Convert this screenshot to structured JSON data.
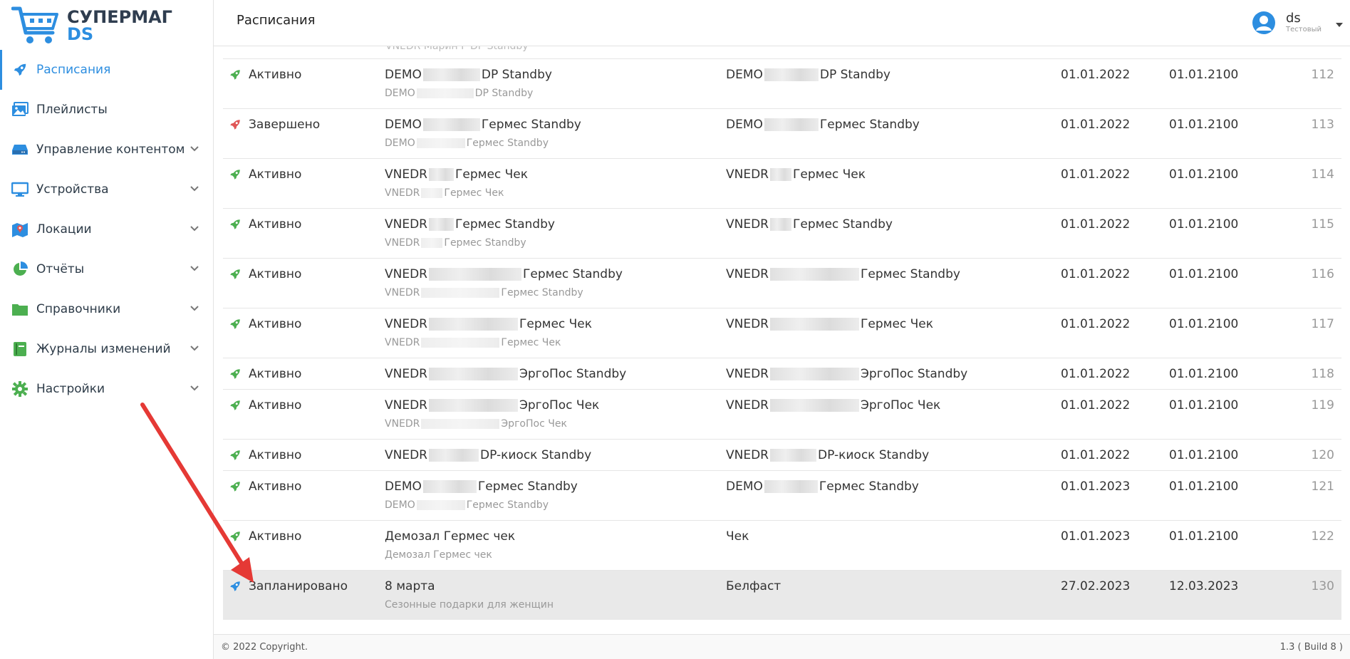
{
  "app": {
    "logo_line1": "СУПЕРМАГ",
    "logo_line2": "DS"
  },
  "colors": {
    "accent": "#2d8ee0",
    "active_rocket": "#4caf50",
    "finished_rocket": "#e05656",
    "planned_rocket": "#2d8ee0"
  },
  "sidebar": {
    "items": [
      {
        "label": "Расписания",
        "icon": "rocket-icon",
        "active": true,
        "expandable": false
      },
      {
        "label": "Плейлисты",
        "icon": "images-icon",
        "active": false,
        "expandable": false
      },
      {
        "label": "Управление контентом",
        "icon": "hdd-icon",
        "active": false,
        "expandable": true
      },
      {
        "label": "Устройства",
        "icon": "monitor-icon",
        "active": false,
        "expandable": true
      },
      {
        "label": "Локации",
        "icon": "map-icon",
        "active": false,
        "expandable": true
      },
      {
        "label": "Отчёты",
        "icon": "pie-chart-icon",
        "active": false,
        "expandable": true
      },
      {
        "label": "Справочники",
        "icon": "folder-icon",
        "active": false,
        "expandable": true
      },
      {
        "label": "Журналы изменений",
        "icon": "book-icon",
        "active": false,
        "expandable": true
      },
      {
        "label": "Настройки",
        "icon": "gear-icon",
        "active": false,
        "expandable": true
      }
    ]
  },
  "header": {
    "title": "Расписания",
    "user_name": "ds",
    "user_role": "Тестовый"
  },
  "table": {
    "cut_row_text": "VNEDR Марин P DP Standby",
    "rows": [
      {
        "status": "Активно",
        "state": "active",
        "name_pre": "DEMO",
        "name_post": "DP Standby",
        "sub_pre": "DEMO",
        "sub_post": "DP Standby",
        "pl_pre": "DEMO",
        "pl_post": "DP Standby",
        "start": "01.01.2022",
        "end": "01.01.2100",
        "id": "112"
      },
      {
        "status": "Завершено",
        "state": "finished",
        "name_pre": "DEMO",
        "name_post": "Гермес Standby",
        "sub_pre": "DEMO",
        "sub_post": "Гермес Standby",
        "pl_pre": "DEMO",
        "pl_post": "Гермес Standby",
        "start": "01.01.2022",
        "end": "01.01.2100",
        "id": "113"
      },
      {
        "status": "Активно",
        "state": "active",
        "name_pre": "VNEDR",
        "name_post": "Гермес Чек",
        "sub_pre": "VNEDR",
        "sub_post": "Гермес Чек",
        "pl_pre": "VNEDR",
        "pl_post": "Гермес Чек",
        "start": "01.01.2022",
        "end": "01.01.2100",
        "id": "114"
      },
      {
        "status": "Активно",
        "state": "active",
        "name_pre": "VNEDR",
        "name_post": "Гермес Standby",
        "sub_pre": "VNEDR",
        "sub_post": "Гермес Standby",
        "pl_pre": "VNEDR",
        "pl_post": "Гермес Standby",
        "start": "01.01.2022",
        "end": "01.01.2100",
        "id": "115"
      },
      {
        "status": "Активно",
        "state": "active",
        "name_pre": "VNEDR",
        "name_post": "Гермес Standby",
        "sub_pre": "VNEDR",
        "sub_post": "Гермес Standby",
        "pl_pre": "VNEDR",
        "pl_post": "Гермес Standby",
        "start": "01.01.2022",
        "end": "01.01.2100",
        "id": "116"
      },
      {
        "status": "Активно",
        "state": "active",
        "name_pre": "VNEDR",
        "name_post": "Гермес Чек",
        "sub_pre": "VNEDR",
        "sub_post": "Гермес Чек",
        "pl_pre": "VNEDR",
        "pl_post": "Гермес Чек",
        "start": "01.01.2022",
        "end": "01.01.2100",
        "id": "117"
      },
      {
        "status": "Активно",
        "state": "active",
        "name_pre": "VNEDR",
        "name_post": "ЭргоПос Standby",
        "sub_pre": "",
        "sub_post": "",
        "pl_pre": "VNEDR",
        "pl_post": "ЭргоПос Standby",
        "start": "01.01.2022",
        "end": "01.01.2100",
        "id": "118"
      },
      {
        "status": "Активно",
        "state": "active",
        "name_pre": "VNEDR",
        "name_post": "ЭргоПос Чек",
        "sub_pre": "VNEDR",
        "sub_post": "ЭргоПос Чек",
        "pl_pre": "VNEDR",
        "pl_post": "ЭргоПос Чек",
        "start": "01.01.2022",
        "end": "01.01.2100",
        "id": "119"
      },
      {
        "status": "Активно",
        "state": "active",
        "name_pre": "VNEDR",
        "name_post": "DP-киоск Standby",
        "sub_pre": "",
        "sub_post": "",
        "pl_pre": "VNEDR",
        "pl_post": "DP-киоск Standby",
        "start": "01.01.2022",
        "end": "01.01.2100",
        "id": "120"
      },
      {
        "status": "Активно",
        "state": "active",
        "name_pre": "DEMO",
        "name_post": "Гермес Standby",
        "sub_pre": "DEMO",
        "sub_post": "Гермес Standby",
        "pl_pre": "DEMO",
        "pl_post": "Гермес Standby",
        "start": "01.01.2023",
        "end": "01.01.2100",
        "id": "121"
      },
      {
        "status": "Активно",
        "state": "active",
        "name_pre": "Демозал Гермес чек",
        "name_post": "",
        "sub_pre": "Демозал Гермес чек",
        "sub_post": "",
        "pl_pre": "Чек",
        "pl_post": "",
        "start": "01.01.2023",
        "end": "01.01.2100",
        "id": "122"
      },
      {
        "status": "Запланировано",
        "state": "planned",
        "name_pre": "8 марта",
        "name_post": "",
        "sub_pre": "Сезонные подарки для женщин",
        "sub_post": "",
        "pl_pre": "Белфаст",
        "pl_post": "",
        "start": "27.02.2023",
        "end": "12.03.2023",
        "id": "130"
      }
    ]
  },
  "footer": {
    "copyright": "© 2022 Copyright.",
    "version": "1.3 ( Build 8 )"
  }
}
